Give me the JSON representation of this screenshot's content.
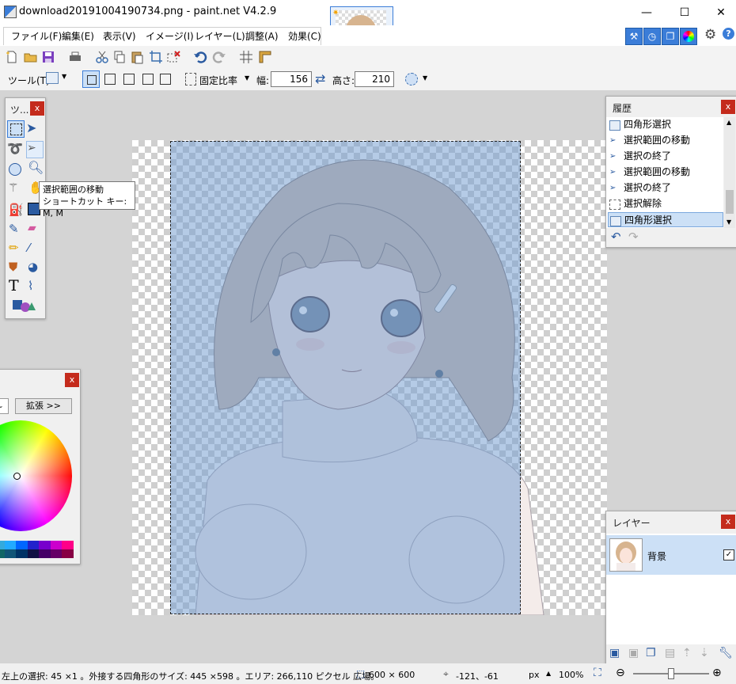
{
  "window": {
    "title": "download20191004190734.png - paint.net V4.2.9",
    "minimize": "—",
    "maximize": "☐",
    "close": "✕"
  },
  "menu": {
    "items": [
      "ファイル(F)",
      "編集(E)",
      "表示(V)",
      "イメージ(I)",
      "レイヤー(L)",
      "調整(A)",
      "効果(C)"
    ]
  },
  "toolbar2": {
    "tool_label": "ツール(T):",
    "fixed_ratio": "固定比率",
    "width_label": "幅:",
    "width_value": "156",
    "height_label": "高さ:",
    "height_value": "210"
  },
  "tools_panel": {
    "title": "ツ...",
    "close": "x",
    "text_tool": "T"
  },
  "tooltip": {
    "line1": "選択範囲の移動",
    "line2": "ショートカット キー: M, M"
  },
  "colors_panel": {
    "close": "x",
    "expand_button": "拡張 >>"
  },
  "history_panel": {
    "title": "履歴",
    "close": "x",
    "items": [
      "四角形選択",
      "選択範囲の移動",
      "選択の終了",
      "選択範囲の移動",
      "選択の終了",
      "選択解除",
      "四角形選択"
    ],
    "selected_index": 6
  },
  "layers_panel": {
    "title": "レイヤー",
    "close": "x",
    "layer_name": "背景",
    "visible": true
  },
  "status": {
    "selection_info": "左上の選択: 45 ×1 。外接する四角形のサイズ: 445 ×598 。エリア: 266,110 ピクセル 広場。",
    "image_size": "600 × 600",
    "cursor_pos": "-121、-61",
    "units": "px",
    "zoom": "100%"
  },
  "colors": {
    "accent": "#3b7dd8",
    "close_red": "#c42b1c",
    "selection_fill": "#9fbfe3"
  }
}
